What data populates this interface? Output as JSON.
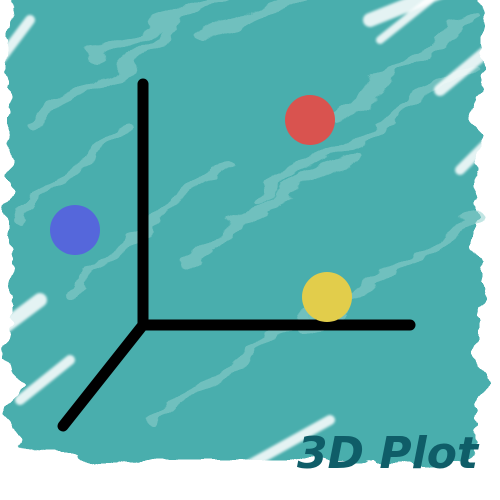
{
  "caption": {
    "text": "3D Plot",
    "color": "#0f5d68"
  },
  "colors": {
    "background_paint": "#4aaead",
    "paint_highlight": "#8fd0cc",
    "axis": "#000000",
    "dot_red": "#d9534f",
    "dot_blue": "#5567db",
    "dot_yellow": "#e2cd4b"
  }
}
